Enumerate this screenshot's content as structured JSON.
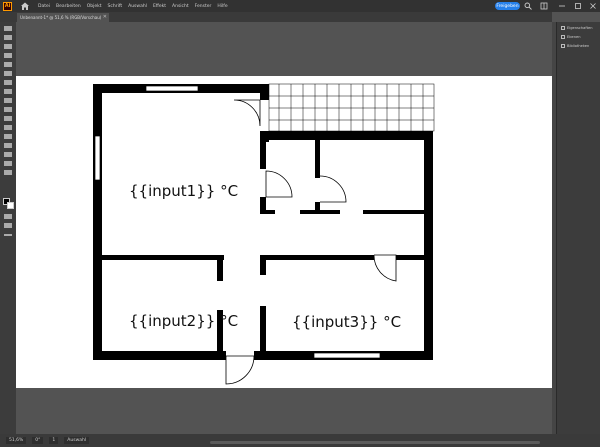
{
  "app": {
    "logo_text": "Ai",
    "menu": [
      "Datei",
      "Bearbeiten",
      "Objekt",
      "Schrift",
      "Auswahl",
      "Effekt",
      "Ansicht",
      "Fenster",
      "Hilfe"
    ],
    "share_label": "Freigeben"
  },
  "document": {
    "tab_title": "Unbenannt-1* @ 51,6 % (RGB/Vorschau)",
    "tab_close": "✕"
  },
  "panels": {
    "items": [
      "Eigenschaften",
      "Ebenen",
      "Bibliotheken"
    ]
  },
  "floorplan": {
    "room_labels": [
      "{{input1}} °C",
      "{{input2}} °C",
      "{{input3}} °C"
    ]
  },
  "status": {
    "zoom": "51,6%",
    "rotation": "0°",
    "artboard_nav": "1",
    "tool_name": "Auswahl"
  },
  "colors": {
    "accent": "#2680eb",
    "wall": "#000000",
    "artboard": "#ffffff",
    "workspace": "#535353"
  }
}
